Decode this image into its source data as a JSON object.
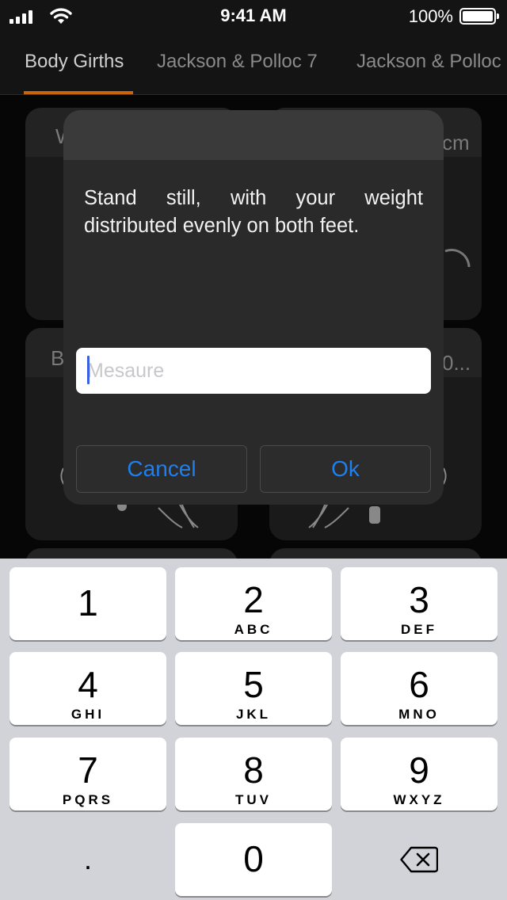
{
  "status_bar": {
    "time": "9:41 AM",
    "battery": "100%"
  },
  "tabs": [
    {
      "label": "Body Girths",
      "active": true
    },
    {
      "label": "Jackson & Polloc 7"
    },
    {
      "label": "Jackson & Polloc"
    }
  ],
  "background": {
    "card_labels": [
      "W",
      "cm",
      "B",
      "0..."
    ]
  },
  "dialog": {
    "message": "Stand still, with your weight distributed evenly on both feet.",
    "input": {
      "value": "",
      "placeholder": "Mesaure"
    },
    "cancel_label": "Cancel",
    "ok_label": "Ok"
  },
  "keypad": {
    "keys": [
      {
        "num": "1",
        "letters": ""
      },
      {
        "num": "2",
        "letters": "ABC"
      },
      {
        "num": "3",
        "letters": "DEF"
      },
      {
        "num": "4",
        "letters": "GHI"
      },
      {
        "num": "5",
        "letters": "JKL"
      },
      {
        "num": "6",
        "letters": "MNO"
      },
      {
        "num": "7",
        "letters": "PQRS"
      },
      {
        "num": "8",
        "letters": "TUV"
      },
      {
        "num": "9",
        "letters": "WXYZ"
      },
      {
        "num": "0",
        "letters": ""
      }
    ],
    "decimal": ".",
    "delete_icon": "backspace-icon"
  },
  "colors": {
    "accent": "#c8640a",
    "button_text": "#1e7ff0",
    "cursor": "#3b5fe0"
  }
}
